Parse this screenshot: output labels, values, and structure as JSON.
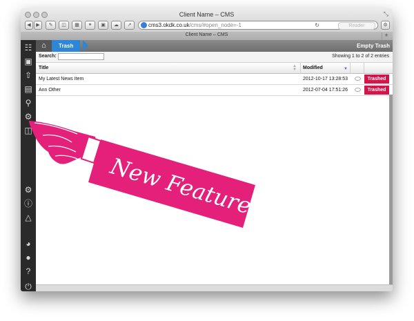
{
  "window": {
    "title": "Client Name – CMS"
  },
  "browser": {
    "url_host": "cms3.okdk.co.uk",
    "url_path": "/cms/#open_node=-1",
    "reader_label": "Reader",
    "tab_title": "Client Name – CMS",
    "new_tab_label": "+"
  },
  "breadcrumb": {
    "current": "Trash"
  },
  "toolbar": {
    "empty_trash": "Empty Trash"
  },
  "search": {
    "label": "Search:",
    "value": ""
  },
  "status": {
    "showing": "Showing 1 to 2 of 2 entries"
  },
  "table": {
    "columns": [
      "Title",
      "Modified"
    ],
    "rows": [
      {
        "title": "My Latest News Item",
        "modified": "2012-10-17 13:28:53",
        "status": "Trashed"
      },
      {
        "title": "Ann Other",
        "modified": "2012-07-04 17:51:26",
        "status": "Trashed"
      }
    ]
  },
  "promo": {
    "text": "New Feature"
  },
  "colors": {
    "accent": "#2d86d6",
    "trashed": "#d3154c",
    "promo": "#e4207a",
    "sidebar": "#2a2a2a"
  }
}
